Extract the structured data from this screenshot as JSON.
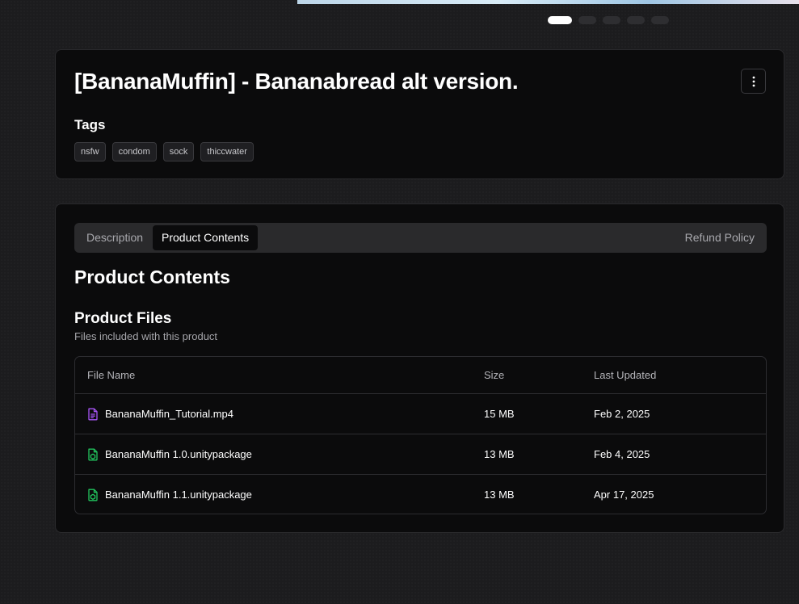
{
  "carousel": {
    "active_index": 0,
    "count": 5
  },
  "product": {
    "title": "[BananaMuffin] - Bananabread alt version.",
    "menu_icon": "more-vertical-icon"
  },
  "tags": {
    "heading": "Tags",
    "items": [
      "nsfw",
      "condom",
      "sock",
      "thiccwater"
    ]
  },
  "tabs": {
    "description": "Description",
    "contents": "Product Contents",
    "refund": "Refund Policy",
    "active": "Product Contents"
  },
  "contents": {
    "title": "Product Contents",
    "files_title": "Product Files",
    "files_subtitle": "Files included with this product",
    "columns": {
      "name": "File Name",
      "size": "Size",
      "updated": "Last Updated"
    },
    "files": [
      {
        "name": "BananaMuffin_Tutorial.mp4",
        "size": "15 MB",
        "updated": "Feb 2, 2025",
        "icon": "video-file-icon",
        "icon_color": "#a855f7"
      },
      {
        "name": "BananaMuffin 1.0.unitypackage",
        "size": "13 MB",
        "updated": "Feb 4, 2025",
        "icon": "package-file-icon",
        "icon_color": "#22c55e"
      },
      {
        "name": "BananaMuffin 1.1.unitypackage",
        "size": "13 MB",
        "updated": "Apr 17, 2025",
        "icon": "package-file-icon",
        "icon_color": "#22c55e"
      }
    ]
  }
}
